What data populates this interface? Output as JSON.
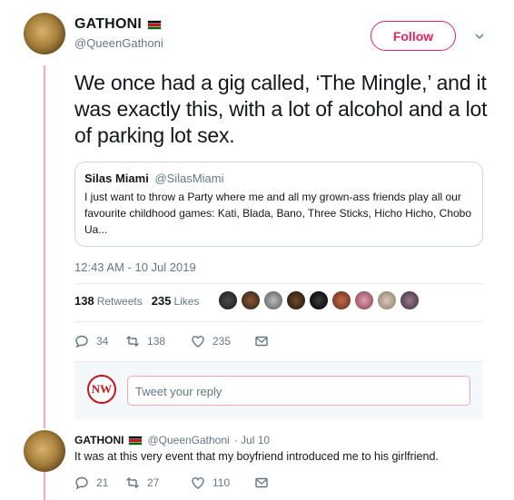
{
  "tweet": {
    "author_name": "GATHONI",
    "author_handle": "@QueenGathoni",
    "follow_label": "Follow",
    "text": "We once had a gig called, ‘The Mingle,’ and it was exactly this, with a lot of alcohol and a lot of parking lot sex.",
    "quote": {
      "name": "Silas Miami",
      "handle": "@SilasMiami",
      "text": "I just want to throw a Party where me and all my grown-ass friends play all our favourite childhood games: Kati, Blada, Bano, Three Sticks, Hicho Hicho, Chobo Ua..."
    },
    "timestamp": "12:43 AM - 10 Jul 2019",
    "retweets_count": "138",
    "retweets_label": "Retweets",
    "likes_count": "235",
    "likes_label": "Likes",
    "actions": {
      "replies": "34",
      "retweets": "138",
      "likes": "235"
    }
  },
  "reply_box": {
    "logo_text": "NW",
    "placeholder": "Tweet your reply"
  },
  "reply": {
    "author_name": "GATHONI",
    "author_handle": "@QueenGathoni",
    "date": "· Jul 10",
    "text": "It was at this very event that my boyfriend introduced me to his girlfriend.",
    "actions": {
      "replies": "21",
      "retweets": "27",
      "likes": "110"
    }
  },
  "colors": {
    "accent": "#e0245e",
    "thread_line": "#f4a8b4",
    "secondary_text": "#657786"
  }
}
